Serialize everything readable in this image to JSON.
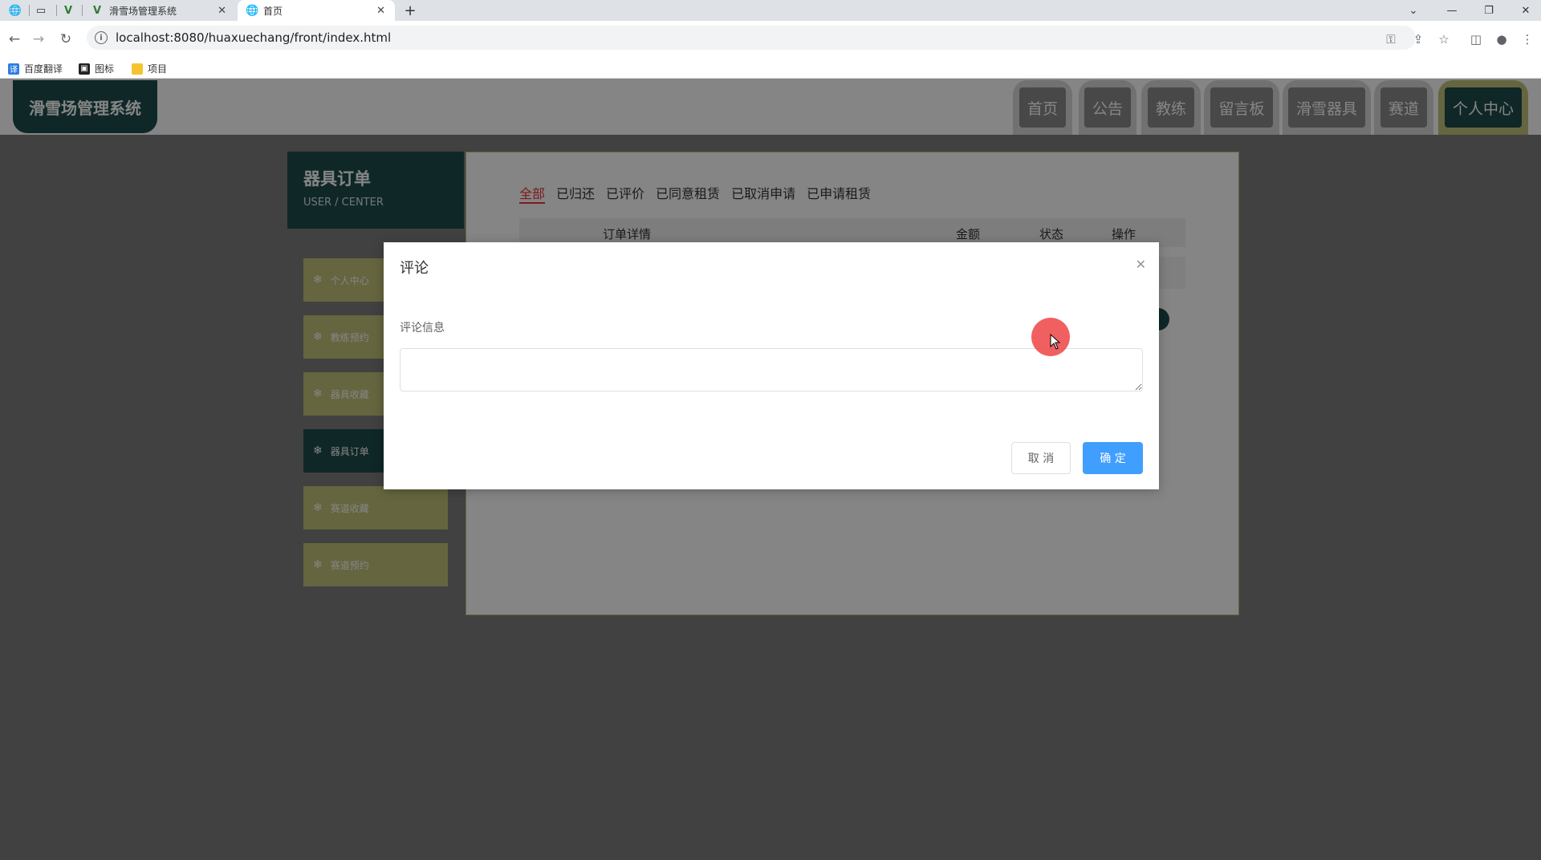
{
  "browser": {
    "tabs": [
      {
        "title": "滑雪场管理系统"
      },
      {
        "title": "首页"
      }
    ],
    "url": "localhost:8080/huaxuechang/front/index.html",
    "bookmarks": [
      "百度翻译",
      "图标",
      "项目"
    ]
  },
  "site": {
    "logo": "滑雪场管理系统",
    "nav": [
      "首页",
      "公告",
      "教练",
      "留言板",
      "滑雪器具",
      "赛道",
      "个人中心"
    ]
  },
  "sidebar": {
    "title": "器具订单",
    "subtitle": "USER / CENTER",
    "items": [
      "个人中心",
      "教练预约",
      "器具收藏",
      "器具订单",
      "赛道收藏",
      "赛道预约"
    ]
  },
  "orders": {
    "tabs": [
      "全部",
      "已归还",
      "已评价",
      "已同意租赁",
      "已取消申请",
      "已申请租赁"
    ],
    "columns": {
      "detail": "订单详情",
      "amount": "金额",
      "status": "状态",
      "action": "操作"
    }
  },
  "modal": {
    "title": "评论",
    "label": "评论信息",
    "textarea_value": "",
    "cancel": "取 消",
    "confirm": "确 定"
  },
  "colors": {
    "primary": "#1e4c4c",
    "accent": "#c2c27a",
    "confirm": "#409eff",
    "tab_active": "#ee3333"
  }
}
